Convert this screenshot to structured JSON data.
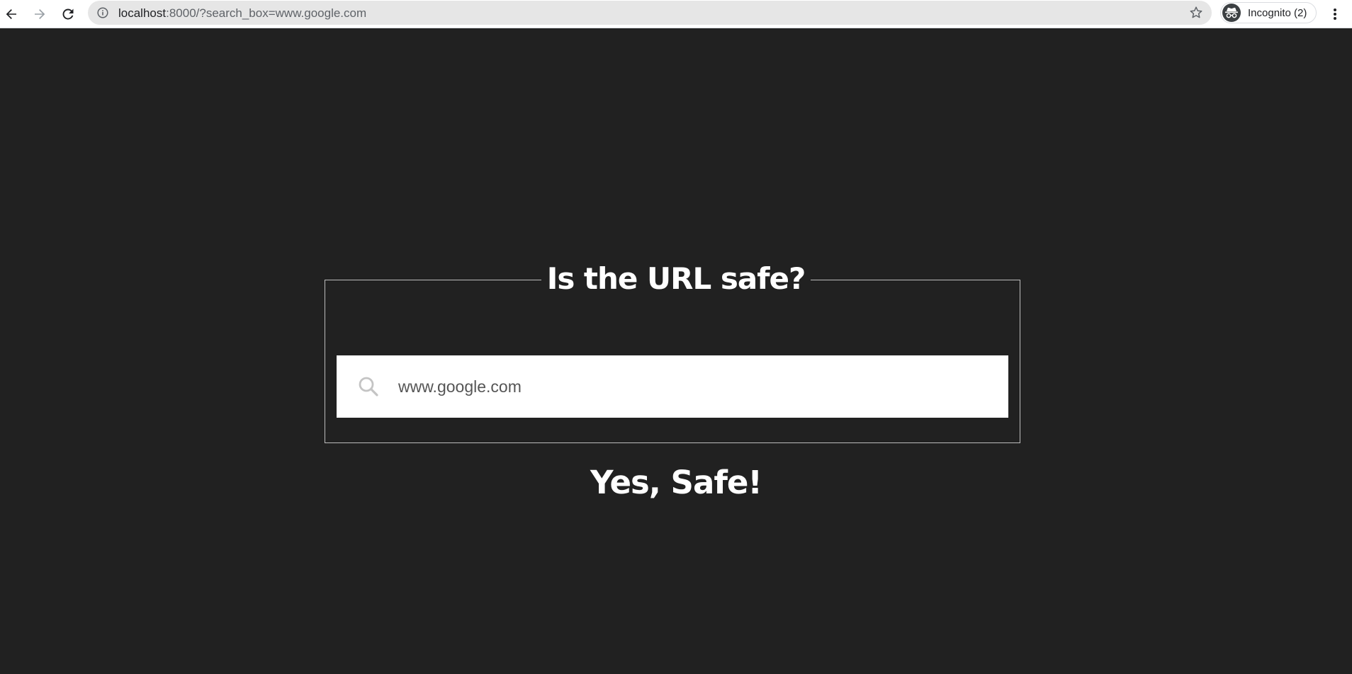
{
  "browser": {
    "url_host": "localhost",
    "url_rest": ":8000/?search_box=www.google.com",
    "profile_label": "Incognito (2)",
    "icons": {
      "back": "arrow-left-icon",
      "forward": "arrow-right-icon",
      "reload": "reload-icon",
      "site_info": "info-icon",
      "bookmark": "star-icon",
      "profile": "incognito-icon",
      "menu": "kebab-menu-icon"
    }
  },
  "page": {
    "title": "Is the URL safe?",
    "search": {
      "value": "www.google.com",
      "icon": "search-icon"
    },
    "result": "Yes, Safe!"
  },
  "colors": {
    "background": "#212121",
    "text": "#ffffff",
    "border": "#bdbdbd",
    "search_bg": "#ffffff"
  }
}
